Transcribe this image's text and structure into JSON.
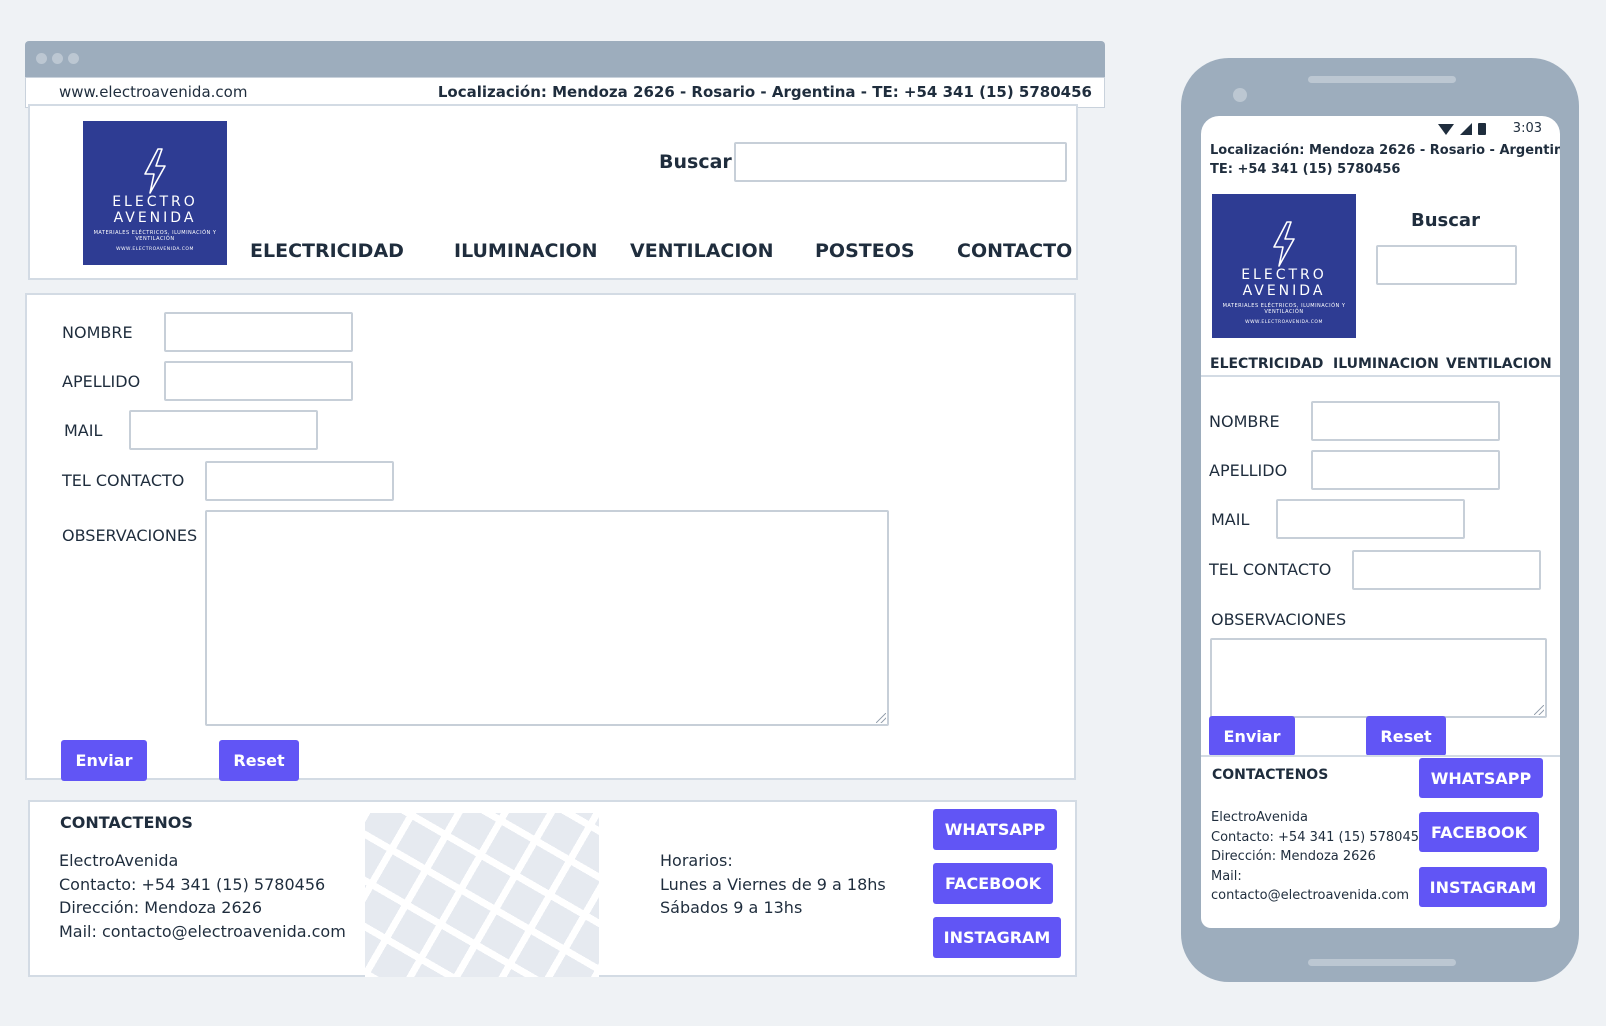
{
  "site": {
    "url": "www.electroavenida.com",
    "location": "Localización: Mendoza 2626 - Rosario - Argentina - TE: +54 341 (15) 5780456",
    "location_line1": "Localización: Mendoza 2626 - Rosario - Argentina -",
    "location_line2": "TE: +54 341 (15) 5780456"
  },
  "logo": {
    "line1": "ELECTRO",
    "line2": "AVENIDA",
    "tagline": "MATERIALES ELÉCTRICOS, ILUMINACIÓN Y VENTILACIÓN",
    "web": "WWW.ELECTROAVENIDA.COM"
  },
  "search": {
    "label": "Buscar",
    "value": ""
  },
  "nav": {
    "items": [
      {
        "label": "ELECTRICIDAD"
      },
      {
        "label": "ILUMINACION"
      },
      {
        "label": "VENTILACION"
      },
      {
        "label": "POSTEOS"
      },
      {
        "label": "CONTACTO"
      }
    ]
  },
  "form": {
    "nombre_label": "NOMBRE",
    "apellido_label": "APELLIDO",
    "mail_label": "MAIL",
    "tel_label": "TEL CONTACTO",
    "obs_label": "OBSERVACIONES",
    "submit_label": "Enviar",
    "reset_label": "Reset"
  },
  "footer": {
    "heading": "CONTACTENOS",
    "name": "ElectroAvenida",
    "contact": "Contacto:  +54 341 (15) 5780456",
    "address": "Dirección: Mendoza 2626",
    "mail": "Mail: contacto@electroavenida.com",
    "mail_label": "Mail:",
    "mail_value": "contacto@electroavenida.com",
    "hours_title": "Horarios:",
    "hours_weekdays": "Lunes a Viernes de 9 a 18hs",
    "hours_saturday": "Sábados 9 a 13hs"
  },
  "social": {
    "whatsapp": "WHATSAPP",
    "facebook": "FACEBOOK",
    "instagram": "INSTAGRAM"
  },
  "phone": {
    "time": "3:03"
  },
  "colors": {
    "background": "#eff2f5",
    "frame": "#9dadbd",
    "accent": "#6155f5",
    "logo": "#2e3c93",
    "text": "#1f2d3d"
  }
}
